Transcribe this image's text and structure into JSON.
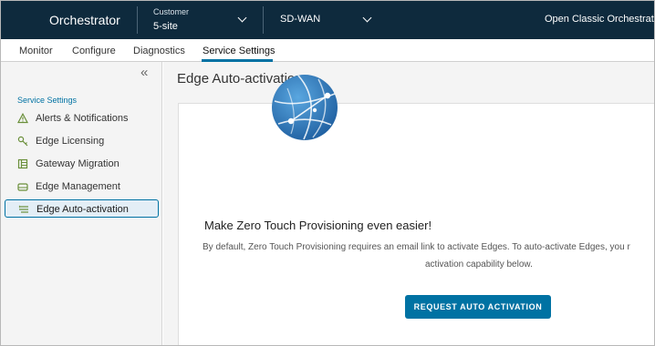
{
  "header": {
    "app_title": "Orchestrator",
    "customer_label": "Customer",
    "customer_value": "5-site",
    "product": "SD-WAN",
    "open_classic": "Open Classic Orchestrator",
    "background": "#0e2a3d"
  },
  "tabs": [
    {
      "label": "Monitor"
    },
    {
      "label": "Configure"
    },
    {
      "label": "Diagnostics"
    },
    {
      "label": "Service Settings",
      "active": true
    }
  ],
  "sidebar": {
    "section_title": "Service Settings",
    "items": [
      {
        "label": "Alerts & Notifications",
        "icon": "alert-triangle-icon"
      },
      {
        "label": "Edge Licensing",
        "icon": "key-icon"
      },
      {
        "label": "Gateway Migration",
        "icon": "gateway-icon"
      },
      {
        "label": "Edge Management",
        "icon": "edge-device-icon"
      },
      {
        "label": "Edge Auto-activation",
        "icon": "auto-activation-icon",
        "active": true
      }
    ]
  },
  "main": {
    "page_title": "Edge Auto-activation",
    "heading": "Make Zero Touch Provisioning even easier!",
    "description_line1": "By default, Zero Touch Provisioning requires an email link to activate Edges. To auto-activate Edges, you r",
    "description_line2": "activation capability below.",
    "button_label": "REQUEST AUTO ACTIVATION",
    "accent_color": "#0072a3",
    "illustration_icon": "globe-network-icon"
  }
}
